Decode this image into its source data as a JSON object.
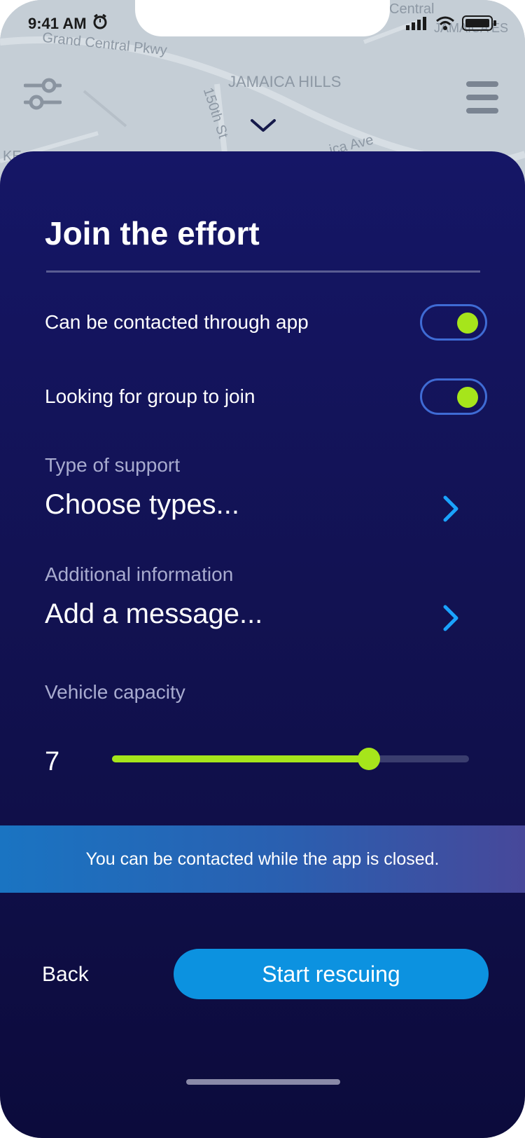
{
  "status_bar": {
    "time": "9:41 AM"
  },
  "map": {
    "labels": [
      "Grand Central Pkwy",
      "JAMAICA HILLS",
      "150th St",
      "Central",
      "JAMAICA ES",
      "KE",
      "ica Ave"
    ]
  },
  "form": {
    "title": "Join the effort",
    "toggles": [
      {
        "label": "Can be contacted through app",
        "on": true
      },
      {
        "label": "Looking for group to join",
        "on": true
      }
    ],
    "support": {
      "label": "Type of support",
      "value": "Choose types..."
    },
    "additional": {
      "label": "Additional information",
      "value": "Add a message..."
    },
    "vehicle": {
      "label": "Vehicle capacity",
      "value": "7",
      "level_fraction": 0.72
    }
  },
  "banner": {
    "text": "You can be contacted while the app is closed."
  },
  "actions": {
    "back": "Back",
    "primary": "Start rescuing"
  },
  "colors": {
    "accent_green": "#a6e51b",
    "primary_blue": "#0c92e0",
    "sheet_navy": "#131462",
    "toggle_border": "#3f6bd4"
  }
}
